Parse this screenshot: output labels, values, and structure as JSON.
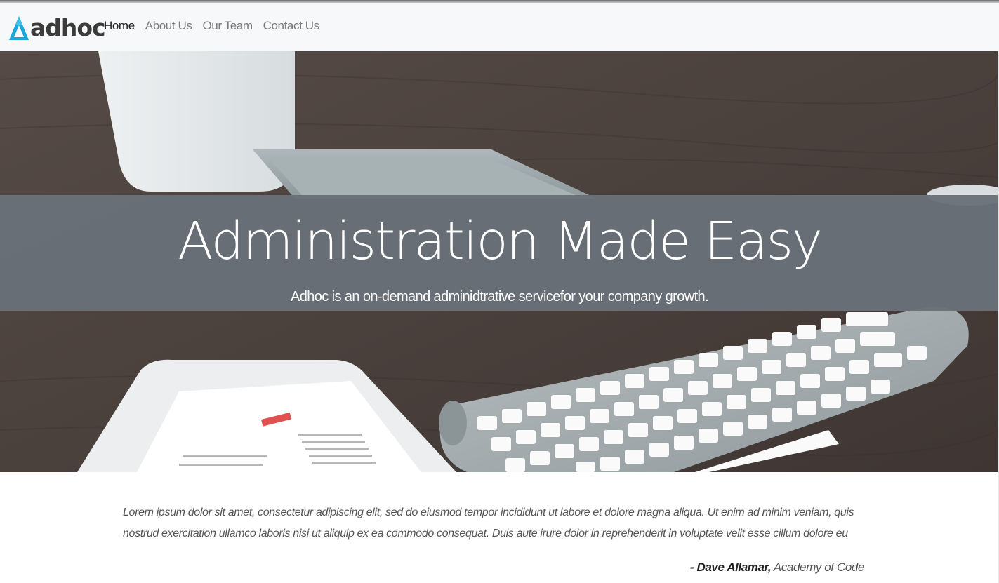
{
  "brand": {
    "name": "adhoc",
    "logo_icon": "triangle-logo-icon",
    "logo_color": "#1aa7d9"
  },
  "nav": {
    "items": [
      {
        "label": "Home",
        "active": true
      },
      {
        "label": "About Us",
        "active": false
      },
      {
        "label": "Our Team",
        "active": false
      },
      {
        "label": "Contact Us",
        "active": false
      }
    ]
  },
  "hero": {
    "title": "Administration Made Easy",
    "subtitle": "Adhoc is an on-demand adminidtrative servicefor your company growth.",
    "background": "desk-with-computer-tablet-keyboard-photo",
    "overlay_color": "#697079"
  },
  "testimonial": {
    "quote": "Lorem ipsum dolor sit amet, consectetur adipiscing elit, sed do eiusmod tempor incididunt ut labore et dolore magna aliqua. Ut enim ad minim veniam, quis nostrud exercitation ullamco laboris nisi ut aliquip ex ea commodo consequat. Duis aute irure dolor in reprehenderit in voluptate velit esse cillum dolore eu",
    "author": "- Dave Allamar,",
    "organization": " Academy of Code"
  }
}
